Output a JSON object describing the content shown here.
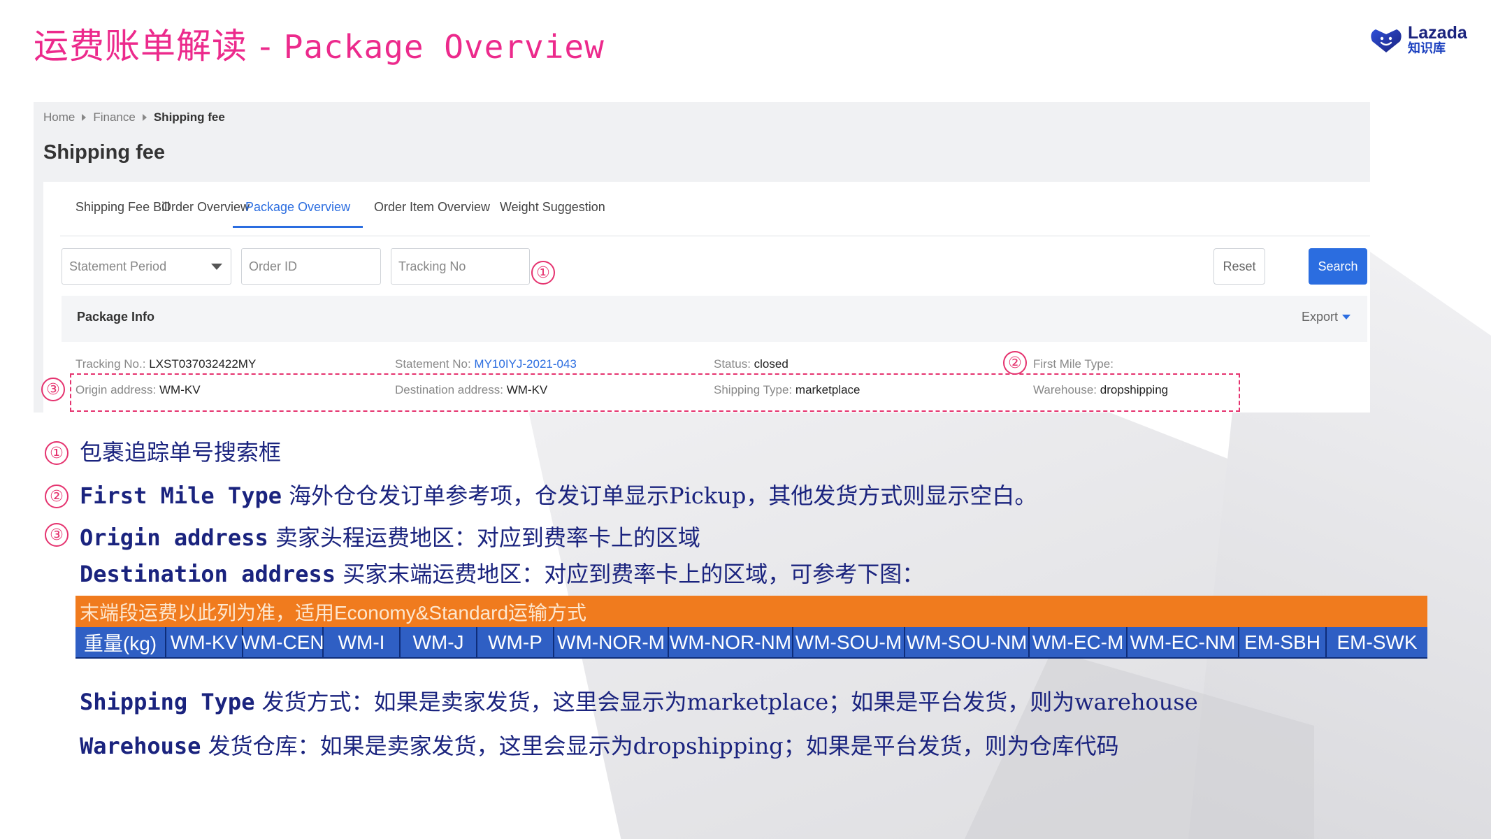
{
  "slide": {
    "title_cn": "运费账单解读 - ",
    "title_en": "Package Overview",
    "brand_name": "Lazada",
    "brand_sub": "知识库"
  },
  "breadcrumb": [
    "Home",
    "Finance",
    "Shipping fee"
  ],
  "page_title": "Shipping fee",
  "tabs": [
    {
      "label": "Shipping Fee Bill",
      "active": false
    },
    {
      "label": "Order Overview",
      "active": false
    },
    {
      "label": "Package Overview",
      "active": true
    },
    {
      "label": "Order Item Overview",
      "active": false
    },
    {
      "label": "Weight Suggestion",
      "active": false
    }
  ],
  "filters": {
    "statement_period": "Statement Period",
    "order_id": "Order ID",
    "tracking_no": "Tracking No"
  },
  "buttons": {
    "reset": "Reset",
    "search": "Search",
    "export": "Export"
  },
  "markers": [
    "①",
    "②",
    "③"
  ],
  "package_info": {
    "title": "Package Info",
    "rows": [
      [
        {
          "key": "Tracking No.:",
          "value": "LXST037032422MY"
        },
        {
          "key": "Statement No:",
          "value": "MY10IYJ-2021-043"
        },
        {
          "key": "Status:",
          "value": "closed"
        },
        {
          "key": "First Mile Type:",
          "value": ""
        }
      ],
      [
        {
          "key": "Origin address:",
          "value": "WM-KV"
        },
        {
          "key": "Destination address:",
          "value": "WM-KV"
        },
        {
          "key": "Shipping Type:",
          "value": "marketplace"
        },
        {
          "key": "Warehouse:",
          "value": "dropshipping"
        }
      ]
    ]
  },
  "notes": {
    "n1": "包裹追踪单号搜索框",
    "n2_key": "First Mile Type",
    "n2_text": "海外仓仓发订单参考项，仓发订单显示Pickup，其他发货方式则显示空白。",
    "n3_key": "Origin address",
    "n3_text": "卖家头程运费地区：对应到费率卡上的区域",
    "n4_key": "Destination address",
    "n4_text": "买家末端运费地区：对应到费率卡上的区域，可参考下图：",
    "n5_key": "Shipping Type",
    "n5_text": "发货方式：如果是卖家发货，这里会显示为marketplace；如果是平台发货，则为warehouse",
    "n6_key": "Warehouse",
    "n6_text": "发货仓库：如果是卖家发货，这里会显示为dropshipping；如果是平台发货，则为仓库代码"
  },
  "rate_card": {
    "header": "末端段运费以此列为准，适用Economy&Standard运输方式",
    "columns": [
      "重量(kg)",
      "WM-KV",
      "WM-CEN",
      "WM-I",
      "WM-J",
      "WM-P",
      "WM-NOR-M",
      "WM-NOR-NM",
      "WM-SOU-M",
      "WM-SOU-NM",
      "WM-EC-M",
      "WM-EC-NM",
      "EM-SBH",
      "EM-SWK"
    ]
  },
  "colors": {
    "title": "#ec2a8c",
    "accent": "#2b6de0",
    "annotation": "#e5336f",
    "note_text": "#1a237e",
    "rate_header": "#f07b1e",
    "rate_row": "#2f5fc4"
  }
}
